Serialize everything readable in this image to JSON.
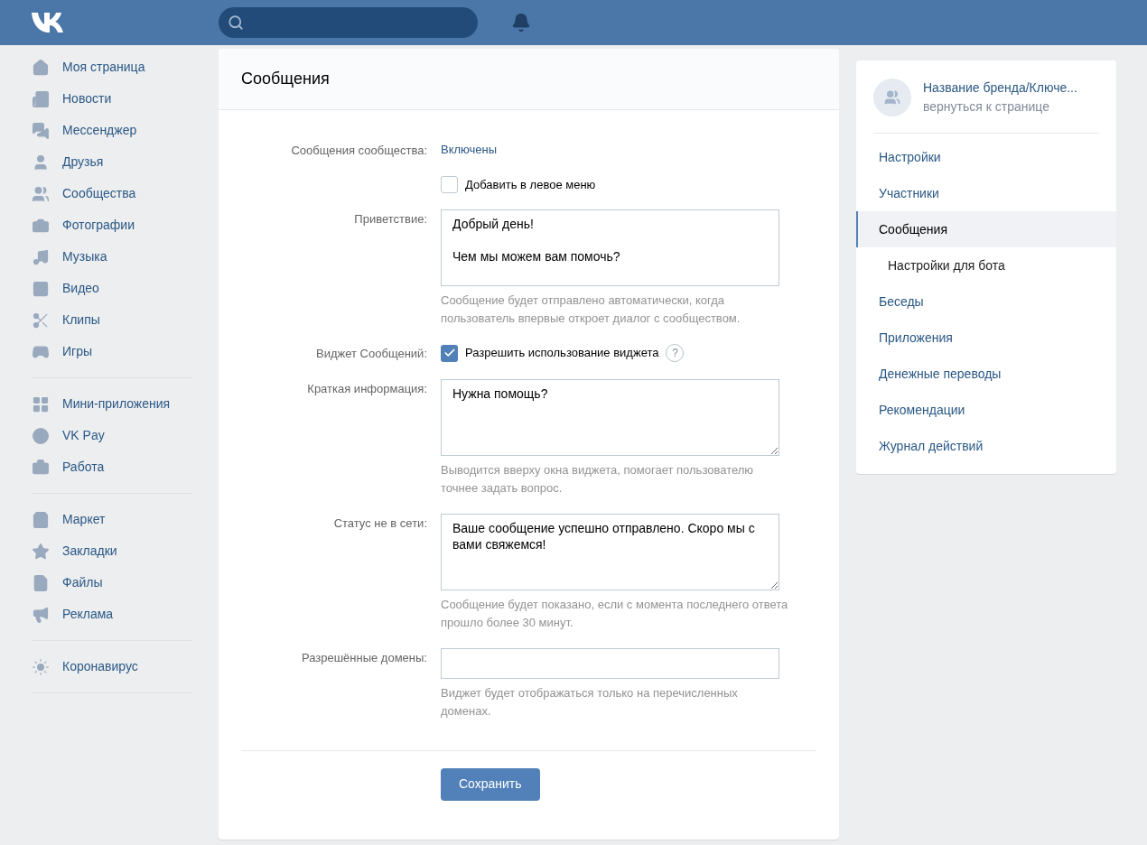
{
  "sidebar": {
    "groups": [
      {
        "items": [
          {
            "label": "Моя страница"
          },
          {
            "label": "Новости"
          },
          {
            "label": "Мессенджер"
          },
          {
            "label": "Друзья"
          },
          {
            "label": "Сообщества"
          },
          {
            "label": "Фотографии"
          },
          {
            "label": "Музыка"
          },
          {
            "label": "Видео"
          },
          {
            "label": "Клипы"
          },
          {
            "label": "Игры"
          }
        ]
      },
      {
        "items": [
          {
            "label": "Мини-приложения"
          },
          {
            "label": "VK Pay"
          },
          {
            "label": "Работа"
          }
        ]
      },
      {
        "items": [
          {
            "label": "Маркет"
          },
          {
            "label": "Закладки"
          },
          {
            "label": "Файлы"
          },
          {
            "label": "Реклама"
          }
        ]
      },
      {
        "items": [
          {
            "label": "Коронавирус"
          }
        ]
      }
    ]
  },
  "main": {
    "title": "Сообщения",
    "rows": [
      {
        "kind": "status",
        "label": "Сообщения сообщества:",
        "value": "Включены"
      },
      {
        "kind": "checkbox",
        "label": "",
        "text": "Добавить в левое меню",
        "checked": false
      },
      {
        "kind": "textarea",
        "label": "Приветствие:",
        "value": "Добрый день!\n\nЧем мы можем вам помочь?",
        "hint": "Сообщение будет отправлено автоматически, когда пользователь впервые откроет диалог с сообществом.",
        "resizable": false
      },
      {
        "kind": "checkbox",
        "label": "Виджет Сообщений:",
        "text": "Разрешить использование виджета",
        "checked": true,
        "help": "?"
      },
      {
        "kind": "textarea",
        "label": "Краткая информация:",
        "value": "Нужна помощь?",
        "hint": "Выводится вверху окна виджета, помогает пользователю точнее задать вопрос.",
        "resizable": true
      },
      {
        "kind": "textarea",
        "label": "Статус не в сети:",
        "value": "Ваше сообщение успешно отправлено. Скоро мы с вами свяжемся!",
        "hint": "Сообщение будет показано, если с момента последнего ответа прошло более 30 минут.",
        "resizable": true
      },
      {
        "kind": "input",
        "label": "Разрешённые домены:",
        "value": "",
        "hint": "Виджет будет отображаться только на перечисленных доменах."
      }
    ],
    "save_button": "Сохранить"
  },
  "right_panel": {
    "community": {
      "name": "Название бренда/Ключе...",
      "link": "вернуться к странице"
    },
    "items": [
      {
        "label": "Настройки",
        "selected": false
      },
      {
        "label": "Участники",
        "selected": false
      },
      {
        "label": "Сообщения",
        "selected": true,
        "children": [
          {
            "label": "Настройки для бота",
            "selected": false
          }
        ]
      },
      {
        "label": "Беседы",
        "selected": false
      },
      {
        "label": "Приложения",
        "selected": false
      },
      {
        "label": "Денежные переводы",
        "selected": false
      },
      {
        "label": "Рекомендации",
        "selected": false
      },
      {
        "label": "Журнал действий",
        "selected": false
      }
    ]
  }
}
